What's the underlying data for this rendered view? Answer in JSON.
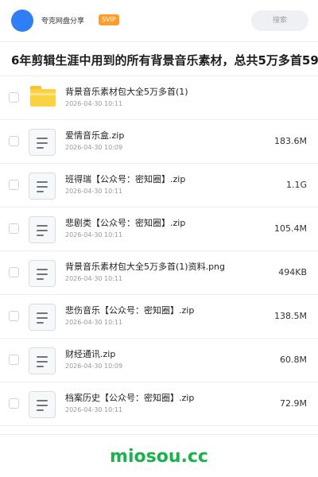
{
  "header": {
    "brand": "夸克网盘分享",
    "badge": "SVIP",
    "search_placeholder": "搜索"
  },
  "share_title": "6年剪辑生涯中用到的所有背景音乐素材，总共5万多首59",
  "files": [
    {
      "icon": "folder-icon",
      "name": "背景音乐素材包大全5万多首(1)",
      "date": "2026-04-30 10:11",
      "size": ""
    },
    {
      "icon": "file-icon",
      "name": "爱情音乐盒.zip",
      "date": "2026-04-30 10:09",
      "size": "183.6M"
    },
    {
      "icon": "file-icon",
      "name": "班得瑞【公众号：密知圈】.zip",
      "date": "2026-04-30 10:11",
      "size": "1.1G"
    },
    {
      "icon": "file-icon",
      "name": "悲剧类【公众号：密知圈】.zip",
      "date": "2026-04-30 10:11",
      "size": "105.4M"
    },
    {
      "icon": "file-icon",
      "name": "背景音乐素材包大全5万多首(1)资料.png",
      "date": "2026-04-30 10:11",
      "size": "494KB"
    },
    {
      "icon": "file-icon",
      "name": "悲伤音乐【公众号：密知圈】.zip",
      "date": "2026-04-30 10:11",
      "size": "138.5M"
    },
    {
      "icon": "file-icon",
      "name": "财经通讯.zip",
      "date": "2026-04-30 10:09",
      "size": "60.8M"
    },
    {
      "icon": "file-icon",
      "name": "档案历史【公众号：密知圈】.zip",
      "date": "2026-04-30 10:11",
      "size": "72.9M"
    }
  ],
  "watermark": "miosou.cc",
  "colors": {
    "accent": "#2f7ef6",
    "svip": "#ff9e2c",
    "folder": "#fbd241",
    "watermark": "#19b34a"
  }
}
